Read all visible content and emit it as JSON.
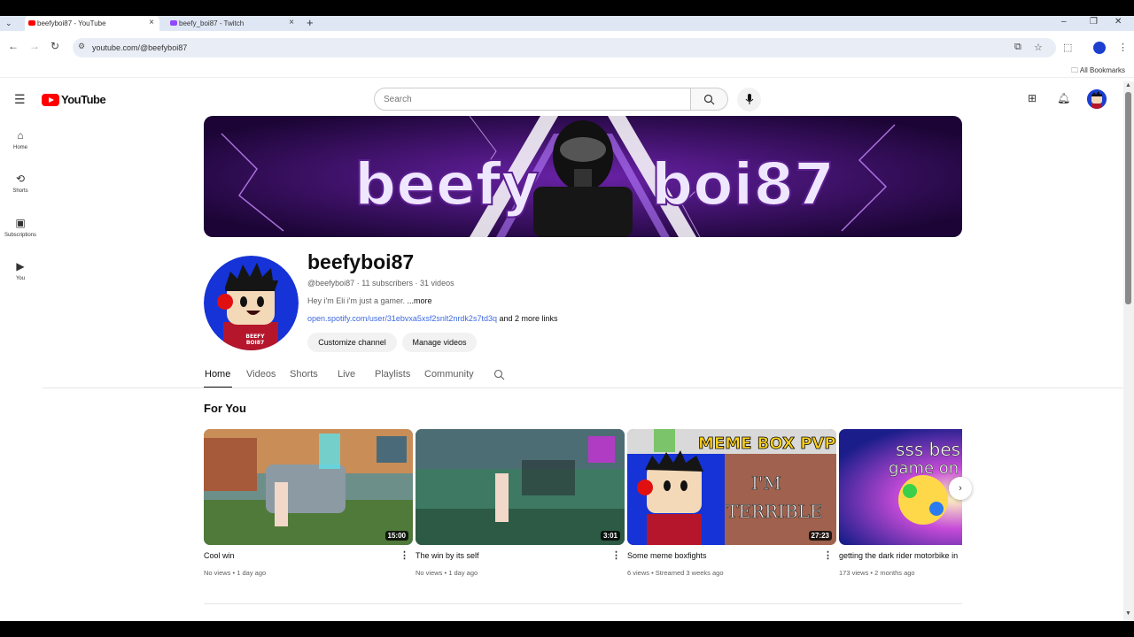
{
  "browser": {
    "tabs": [
      {
        "title": "beefyboi87 - YouTube",
        "active": true,
        "favicon_color": "#ff0000"
      },
      {
        "title": "beefy_boi87 - Twitch",
        "active": false,
        "favicon_color": "#9146ff"
      }
    ],
    "url": "youtube.com/@beefyboi87",
    "bookmarks_label": "All Bookmarks"
  },
  "yt": {
    "logo_text": "YouTube",
    "search_placeholder": "Search",
    "guide": [
      {
        "label": "Home",
        "icon": "home-icon"
      },
      {
        "label": "Shorts",
        "icon": "shorts-icon"
      },
      {
        "label": "Subscriptions",
        "icon": "subscriptions-icon"
      },
      {
        "label": "You",
        "icon": "you-icon"
      }
    ]
  },
  "banner": {
    "word_left": "beefy",
    "word_right": "boi87"
  },
  "channel": {
    "name": "beefyboi87",
    "handle": "@beefyboi87",
    "subscribers": "11 subscribers",
    "videos": "31 videos",
    "description": "Hey i'm Eli i'm just a gamer.",
    "more": "...more",
    "link": "open.spotify.com/user/31ebvxa5xsf2snlt2nrdk2s7td3q",
    "more_links": "and 2 more links",
    "customize_label": "Customize channel",
    "manage_label": "Manage videos",
    "avatar_shirt_text_1": "BEEFY",
    "avatar_shirt_text_2": "BOI87"
  },
  "tabs": [
    "Home",
    "Videos",
    "Shorts",
    "Live",
    "Playlists",
    "Community"
  ],
  "section_title": "For You",
  "videos": [
    {
      "title": "Cool win",
      "meta": "No views • 1 day ago",
      "duration": "15:00"
    },
    {
      "title": "The win by its self",
      "meta": "No views • 1 day ago",
      "duration": "3:01"
    },
    {
      "title": "Some meme boxfights",
      "meta": "6 views • Streamed 3 weeks ago",
      "duration": "27:23",
      "thumb_text_1": "MEME BOX PVP",
      "thumb_text_2": "I'M",
      "thumb_text_3": "TERRIBLE"
    },
    {
      "title": "getting the dark rider motorbike in",
      "meta": "173 views • 2 months ago",
      "duration": "",
      "thumb_text_1": "sss bes",
      "thumb_text_2": "game on"
    }
  ],
  "colors": {
    "accent_red": "#ff0000",
    "link_blue": "#3e6ae1",
    "banner_purple": "#3a0f5e"
  }
}
